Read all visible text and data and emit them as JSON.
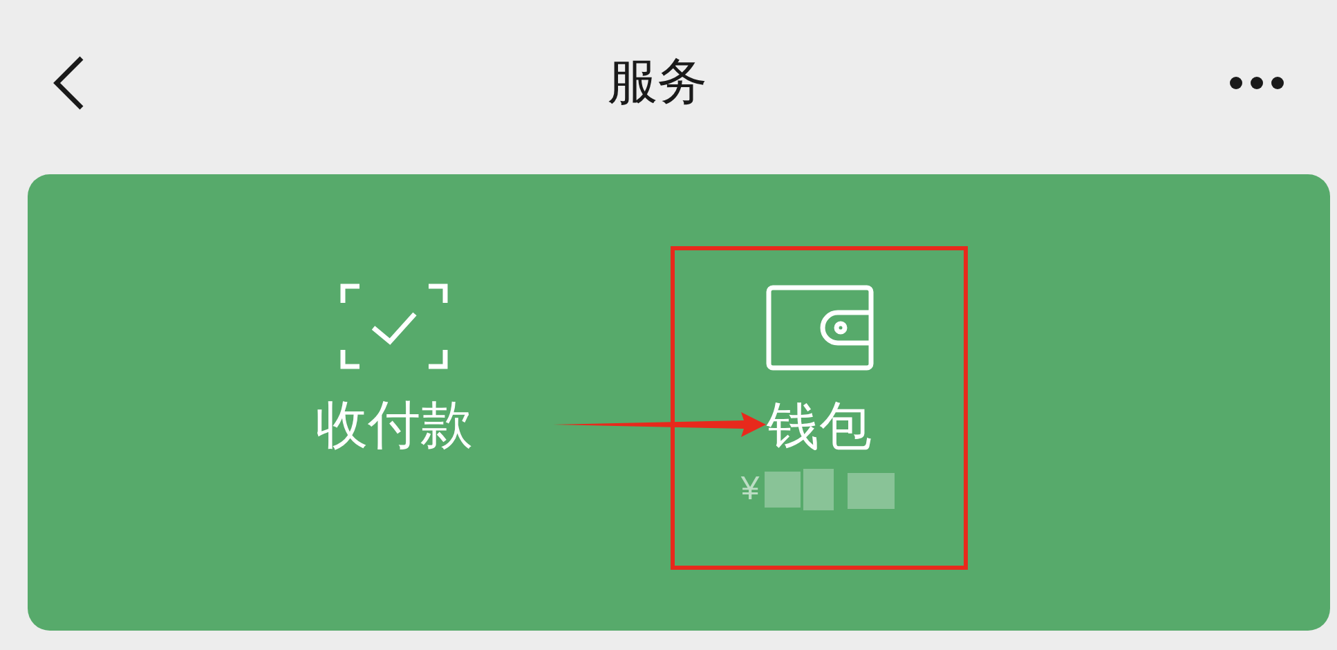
{
  "header": {
    "title": "服务"
  },
  "actions": [
    {
      "kind": "scan",
      "label": "收付款"
    },
    {
      "kind": "wallet",
      "label": "钱包",
      "balance": "¥",
      "highlighted": true
    }
  ]
}
